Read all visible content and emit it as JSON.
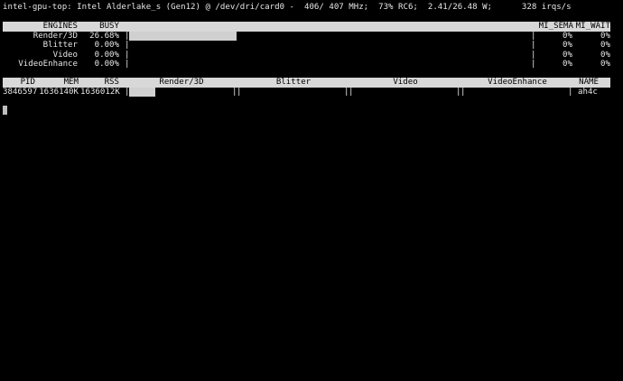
{
  "title_line": "intel-gpu-top: Intel Alderlake_s (Gen12) @ /dev/dri/card0 -  406/ 407 MHz;  73% RC6;  2.41/26.48 W;      328 irqs/s",
  "engines_header": {
    "engines": "ENGINES",
    "busy": "BUSY",
    "mi_sema": "MI_SEMA",
    "mi_wait": "MI_WAIT"
  },
  "engines": [
    {
      "name": "Render/3D",
      "busy": "26.68%",
      "busy_fraction": 0.2668,
      "mi_sema": "0%",
      "mi_wait": "0%"
    },
    {
      "name": "Blitter",
      "busy": "0.00%",
      "busy_fraction": 0.0,
      "mi_sema": "0%",
      "mi_wait": "0%"
    },
    {
      "name": "Video",
      "busy": "0.00%",
      "busy_fraction": 0.0,
      "mi_sema": "0%",
      "mi_wait": "0%"
    },
    {
      "name": "VideoEnhance",
      "busy": "0.00%",
      "busy_fraction": 0.0,
      "mi_sema": "0%",
      "mi_wait": "0%"
    }
  ],
  "clients_header": {
    "pid": "PID",
    "mem": "MEM",
    "rss": "RSS",
    "render": "Render/3D",
    "blitter": "Blitter",
    "video": "Video",
    "videoenhance": "VideoEnhance",
    "name": "NAME"
  },
  "clients": [
    {
      "pid": "3846597",
      "mem": "1636140K",
      "rss": "1636012K",
      "render_fraction": 0.25,
      "blitter_fraction": 0.0,
      "video_fraction": 0.0,
      "videoenhance_fraction": 0.0,
      "name": "ah4c"
    }
  ],
  "separator": "|"
}
